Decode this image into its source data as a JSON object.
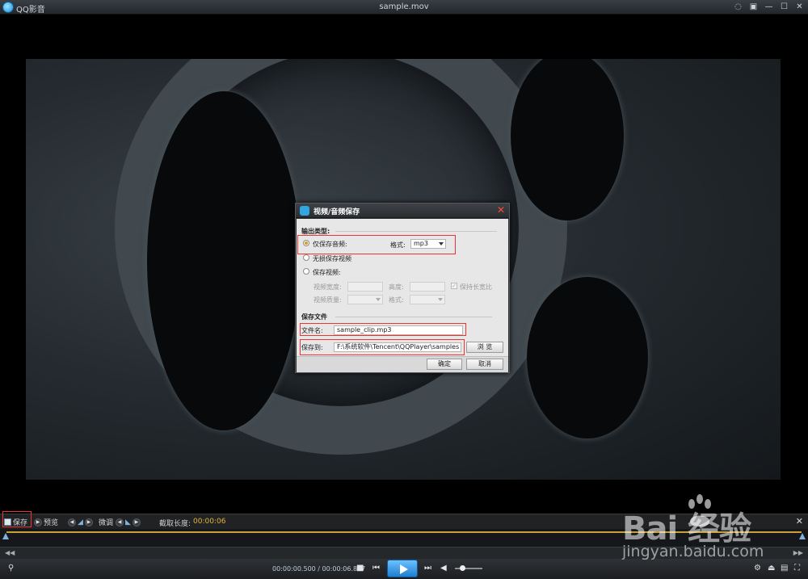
{
  "app": {
    "name": "QQ影音",
    "window_title": "sample.mov"
  },
  "dialog": {
    "title": "视频/音频保存",
    "output_section": "输出类型:",
    "opt_audio_only": "仅保存音频:",
    "audio_format_label": "格式:",
    "audio_format_value": "mp3",
    "opt_lossless_video": "无损保存视频",
    "opt_save_video": "保存视频:",
    "video_width_label": "视频宽度:",
    "height_label": "高度:",
    "keep_ratio_label": "保持长宽比",
    "video_quality_label": "视频质量:",
    "video_format_label": "格式:",
    "file_section": "保存文件",
    "filename_label": "文件名:",
    "filename_value": "sample_clip.mp3",
    "saveto_label": "保存到:",
    "saveto_value": "F:\\系统软件\\Tencent\\QQPlayer\\samples",
    "browse_button": "浏 览",
    "ok_button": "确定",
    "cancel_button": "取消",
    "selected_option": "audio_only"
  },
  "edit_bar": {
    "save_label": "保存",
    "preview_label": "预览",
    "finetune_label": "微调",
    "duration_label": "截取长度:",
    "duration_value": "00:00:06"
  },
  "controls": {
    "time_display": "00:00:00.500 / 00:00:06.837",
    "volume_level": 0.25
  },
  "watermark": {
    "brand": "Bai 经验",
    "url": "jingyan.baidu.com"
  },
  "colors": {
    "accent": "#1d7fd0",
    "highlight": "#e33333",
    "timeline": "#c9a13c",
    "duration": "#e4b53c"
  }
}
